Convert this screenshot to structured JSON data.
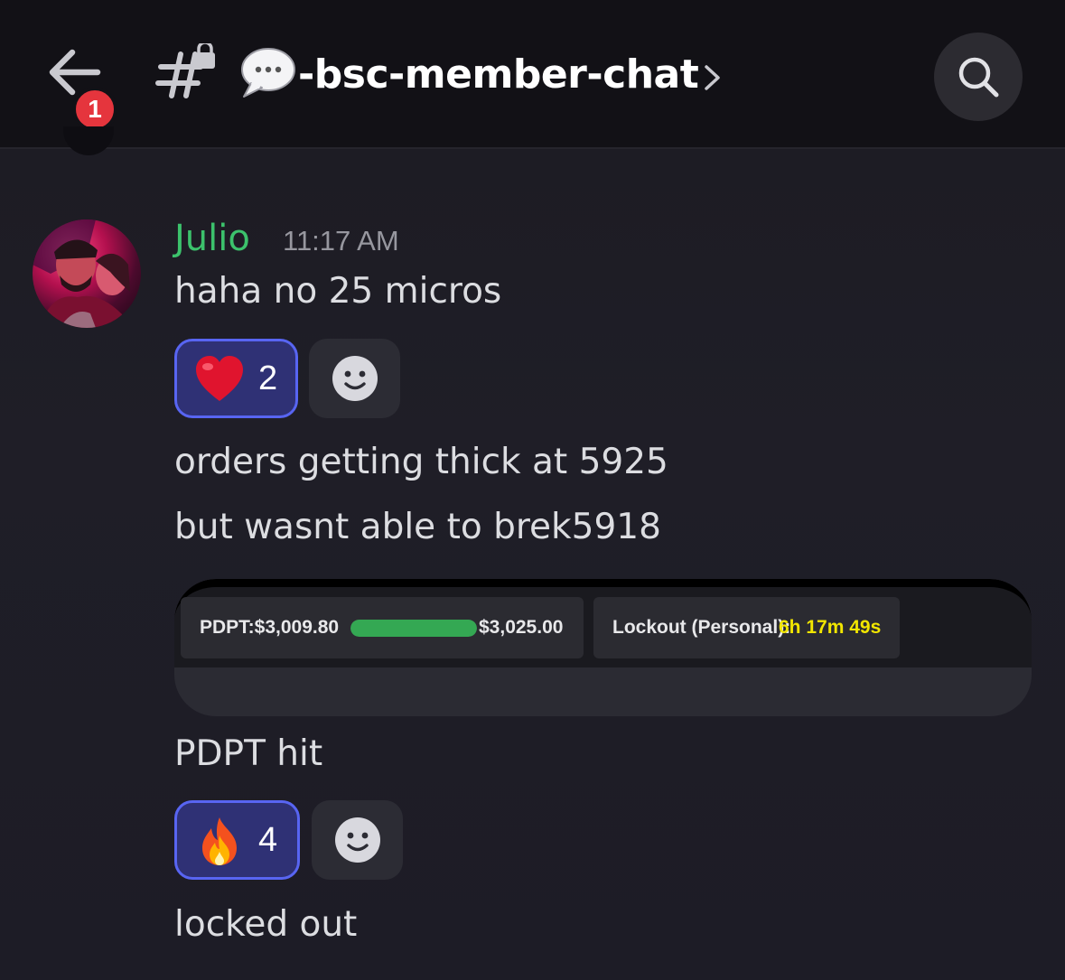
{
  "header": {
    "back_badge_count": "1",
    "channel_emoji": "speech-bubble",
    "channel_name": "-bsc-member-chat",
    "icons": [
      "back-arrow-icon",
      "hashtag-lock-icon",
      "speech-bubble-icon",
      "chevron-right-icon",
      "search-icon"
    ]
  },
  "message": {
    "author": "Julio",
    "author_color": "#3cc26c",
    "timestamp": "11:17 AM",
    "lines": [
      "haha no 25 micros",
      "orders getting thick at 5925",
      "but wasnt able to brek5918",
      "PDPT hit",
      "locked out"
    ],
    "reactions": [
      {
        "emoji": "heart",
        "count": "2"
      },
      {
        "emoji": "fire",
        "count": "4"
      }
    ],
    "attachment": {
      "pdpt_label": "PDPT:$3,009.80",
      "pdpt_target": "$3,025.00",
      "pdpt_progress": 1.0,
      "lockout_label": "Lockout (Personal):",
      "lockout_time": "6h 17m 49s",
      "progress_color": "#34a853",
      "lockout_time_color": "#f2e600"
    }
  },
  "colors": {
    "header_bg": "#121116",
    "reaction_bg": "#2f3175",
    "reaction_border": "#5865f2",
    "badge": "#e5353d"
  }
}
